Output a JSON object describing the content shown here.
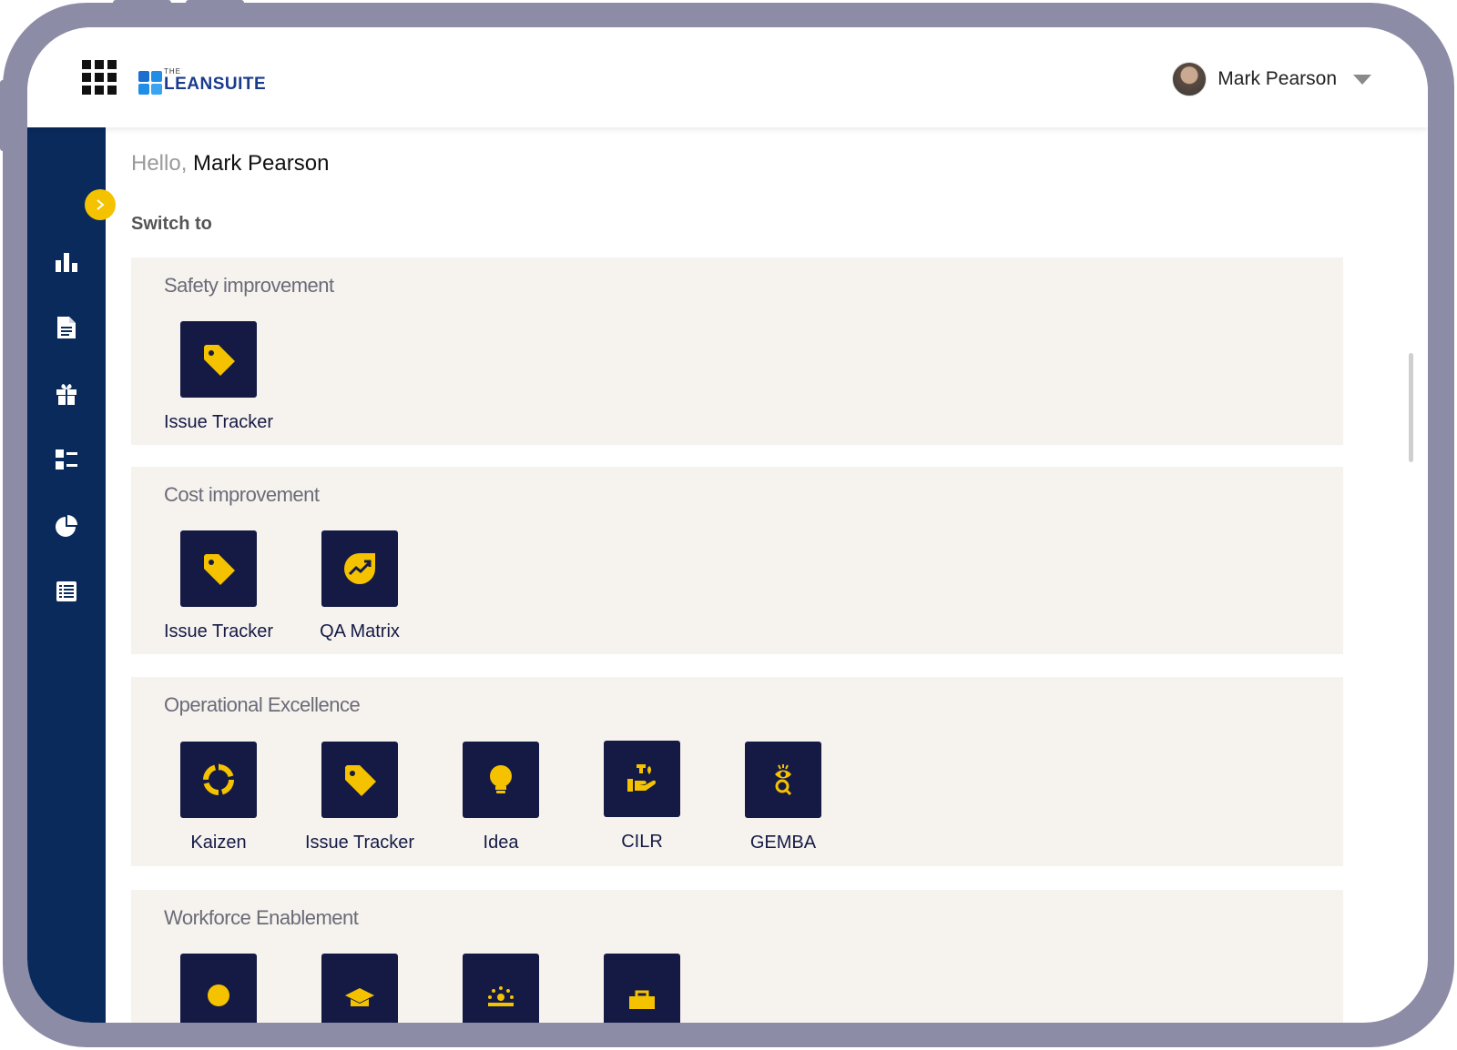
{
  "header": {
    "logo_the": "THE",
    "logo_name": "LEANSUITE",
    "user_name": "Mark Pearson"
  },
  "greeting": {
    "hello": "Hello, ",
    "name": "Mark Pearson"
  },
  "switch_label": "Switch to",
  "sidebar": {
    "items": [
      {
        "icon": "bar-chart-icon"
      },
      {
        "icon": "document-icon"
      },
      {
        "icon": "gift-icon"
      },
      {
        "icon": "task-list-icon"
      },
      {
        "icon": "pie-chart-icon"
      },
      {
        "icon": "list-icon"
      }
    ]
  },
  "sections": [
    {
      "title": "Safety improvement",
      "tiles": [
        {
          "label": "Issue Tracker",
          "icon": "tag-icon"
        }
      ]
    },
    {
      "title": "Cost improvement",
      "tiles": [
        {
          "label": "Issue Tracker",
          "icon": "tag-icon"
        },
        {
          "label": "QA Matrix",
          "icon": "trend-chart-icon"
        }
      ]
    },
    {
      "title": "Operational Excellence",
      "tiles": [
        {
          "label": "Kaizen",
          "icon": "cycle-icon"
        },
        {
          "label": "Issue Tracker",
          "icon": "tag-icon"
        },
        {
          "label": "Idea",
          "icon": "lightbulb-icon"
        },
        {
          "label": "CILR",
          "icon": "hand-oil-icon"
        },
        {
          "label": "GEMBA",
          "icon": "eye-search-icon"
        }
      ]
    },
    {
      "title": "Workforce Enablement",
      "tiles": [
        {
          "label": "",
          "icon": "lightbulb-icon"
        },
        {
          "label": "",
          "icon": "graduation-cap-icon"
        },
        {
          "label": "",
          "icon": "person-spark-icon"
        },
        {
          "label": "",
          "icon": "briefcase-icon"
        }
      ]
    }
  ],
  "colors": {
    "sidebar": "#0a2a5c",
    "accent": "#f5c200",
    "tile": "#151a45",
    "section_bg": "#f6f3ef",
    "bezel": "#8c8ca6"
  }
}
